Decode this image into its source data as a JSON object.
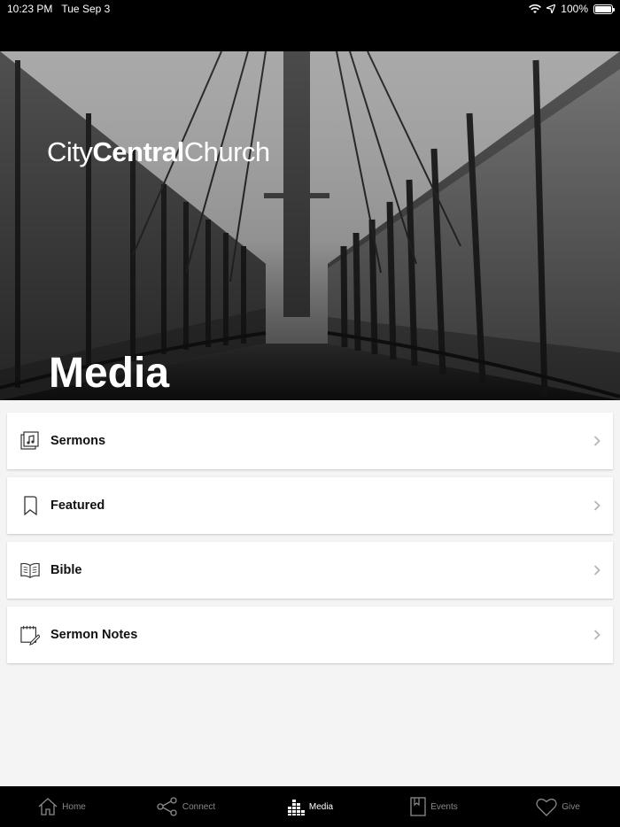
{
  "status": {
    "time": "10:23 PM",
    "date": "Tue Sep 3",
    "battery": "100%"
  },
  "brand": {
    "part1": "City",
    "part2": "Central",
    "part3": "Church"
  },
  "page": {
    "title": "Media"
  },
  "menu": [
    {
      "label": "Sermons",
      "icon": "music-note-icon"
    },
    {
      "label": "Featured",
      "icon": "bookmark-icon"
    },
    {
      "label": "Bible",
      "icon": "open-book-icon"
    },
    {
      "label": "Sermon Notes",
      "icon": "notepad-pencil-icon"
    }
  ],
  "tabs": [
    {
      "label": "Home",
      "icon": "home-icon"
    },
    {
      "label": "Connect",
      "icon": "share-icon"
    },
    {
      "label": "Media",
      "icon": "media-icon",
      "active": true
    },
    {
      "label": "Events",
      "icon": "events-icon"
    },
    {
      "label": "Give",
      "icon": "heart-icon"
    }
  ]
}
